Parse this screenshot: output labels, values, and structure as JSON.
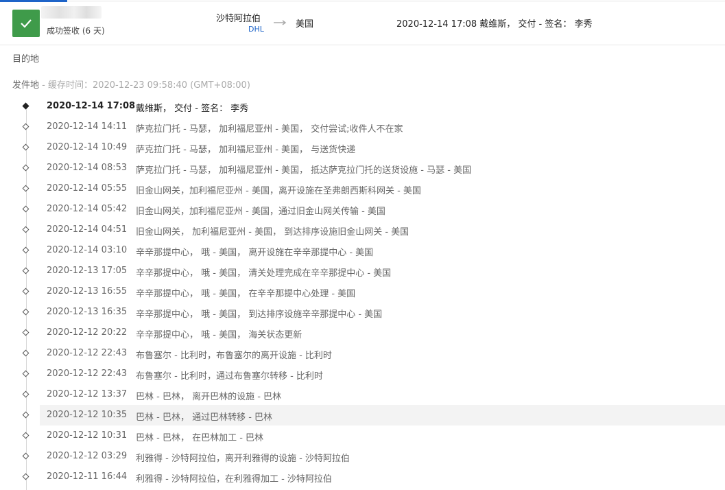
{
  "header": {
    "status_text": "成功签收 (6 天)",
    "origin_country": "沙特阿拉伯",
    "carrier": "DHL",
    "destination_country": "美国",
    "latest_event": "2020-12-14 17:08  戴维斯， 交付 - 签名： 李秀"
  },
  "section": {
    "destination_label": "目的地",
    "origin_label": "发件地",
    "cache_text": " - 缓存时间：2020-12-23 09:58:40 (GMT+08:00)"
  },
  "events": [
    {
      "time": "2020-12-14 17:08",
      "desc": "戴维斯， 交付 - 签名： 李秀"
    },
    {
      "time": "2020-12-14 14:11",
      "desc": "萨克拉门托 - 马瑟， 加利福尼亚州 - 美国， 交付尝试;收件人不在家"
    },
    {
      "time": "2020-12-14 10:49",
      "desc": "萨克拉门托 - 马瑟， 加利福尼亚州 - 美国， 与送货快递"
    },
    {
      "time": "2020-12-14 08:53",
      "desc": "萨克拉门托 - 马瑟， 加利福尼亚州 - 美国， 抵达萨克拉门托的送货设施 - 马瑟 - 美国"
    },
    {
      "time": "2020-12-14 05:55",
      "desc": "旧金山网关，加利福尼亚州 - 美国，离开设施在圣弗朗西斯科网关 - 美国"
    },
    {
      "time": "2020-12-14 05:42",
      "desc": "旧金山网关，加利福尼亚州 - 美国，通过旧金山网关传输 - 美国"
    },
    {
      "time": "2020-12-14 04:51",
      "desc": "旧金山网关， 加利福尼亚州 - 美国， 到达排序设施旧金山网关 - 美国"
    },
    {
      "time": "2020-12-14 03:10",
      "desc": "辛辛那提中心， 哦 - 美国， 离开设施在辛辛那提中心 - 美国"
    },
    {
      "time": "2020-12-13 17:05",
      "desc": "辛辛那提中心， 哦 - 美国， 清关处理完成在辛辛那提中心 - 美国"
    },
    {
      "time": "2020-12-13 16:55",
      "desc": "辛辛那提中心， 哦 - 美国， 在辛辛那提中心处理 - 美国"
    },
    {
      "time": "2020-12-13 16:35",
      "desc": "辛辛那提中心， 哦 - 美国， 到达排序设施辛辛那提中心 - 美国"
    },
    {
      "time": "2020-12-12 20:22",
      "desc": "辛辛那提中心， 哦 - 美国， 海关状态更新"
    },
    {
      "time": "2020-12-12 22:43",
      "desc": "布鲁塞尔 - 比利时，布鲁塞尔的离开设施 - 比利时"
    },
    {
      "time": "2020-12-12 22:43",
      "desc": "布鲁塞尔 - 比利时，通过布鲁塞尔转移 - 比利时"
    },
    {
      "time": "2020-12-12 13:37",
      "desc": "巴林 - 巴林， 离开巴林的设施 - 巴林"
    },
    {
      "time": "2020-12-12 10:35",
      "desc": "巴林 - 巴林， 通过巴林转移 - 巴林"
    },
    {
      "time": "2020-12-12 10:31",
      "desc": "巴林 - 巴林， 在巴林加工 - 巴林"
    },
    {
      "time": "2020-12-12 03:29",
      "desc": "利雅得 - 沙特阿拉伯，离开利雅得的设施 - 沙特阿拉伯"
    },
    {
      "time": "2020-12-11 16:44",
      "desc": "利雅得 - 沙特阿拉伯，在利雅得加工 - 沙特阿拉伯"
    }
  ],
  "colors": {
    "success": "#3f9b4a",
    "link": "#1e64c8",
    "highlight_row": "#f3f3f3"
  },
  "icons": [
    "check-icon",
    "arrow-right-icon",
    "diamond-icon"
  ]
}
